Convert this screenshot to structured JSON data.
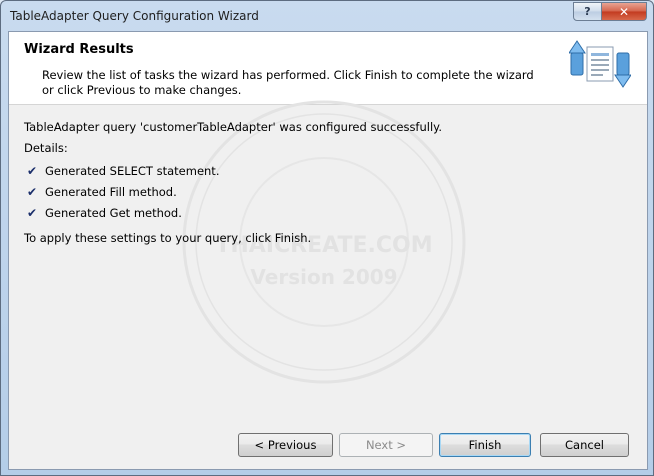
{
  "window": {
    "title": "TableAdapter Query Configuration Wizard",
    "help_label": "?",
    "close_label": "✕"
  },
  "header": {
    "title": "Wizard Results",
    "description": "Review the list of tasks the wizard has performed. Click Finish to complete the wizard or click Previous to make changes."
  },
  "results": {
    "summary": "TableAdapter query 'customerTableAdapter' was configured successfully.",
    "details_label": "Details:",
    "items": [
      "Generated SELECT statement.",
      "Generated Fill method.",
      "Generated Get method."
    ],
    "apply_hint": "To apply these settings to your query, click Finish."
  },
  "watermark": {
    "line1": "THAICREATE.COM",
    "line2": "Version 2009"
  },
  "buttons": {
    "previous": "< Previous",
    "next": "Next >",
    "finish": "Finish",
    "cancel": "Cancel"
  },
  "icons": {
    "check": "checkmark-icon",
    "wizard": "database-arrows-icon"
  }
}
